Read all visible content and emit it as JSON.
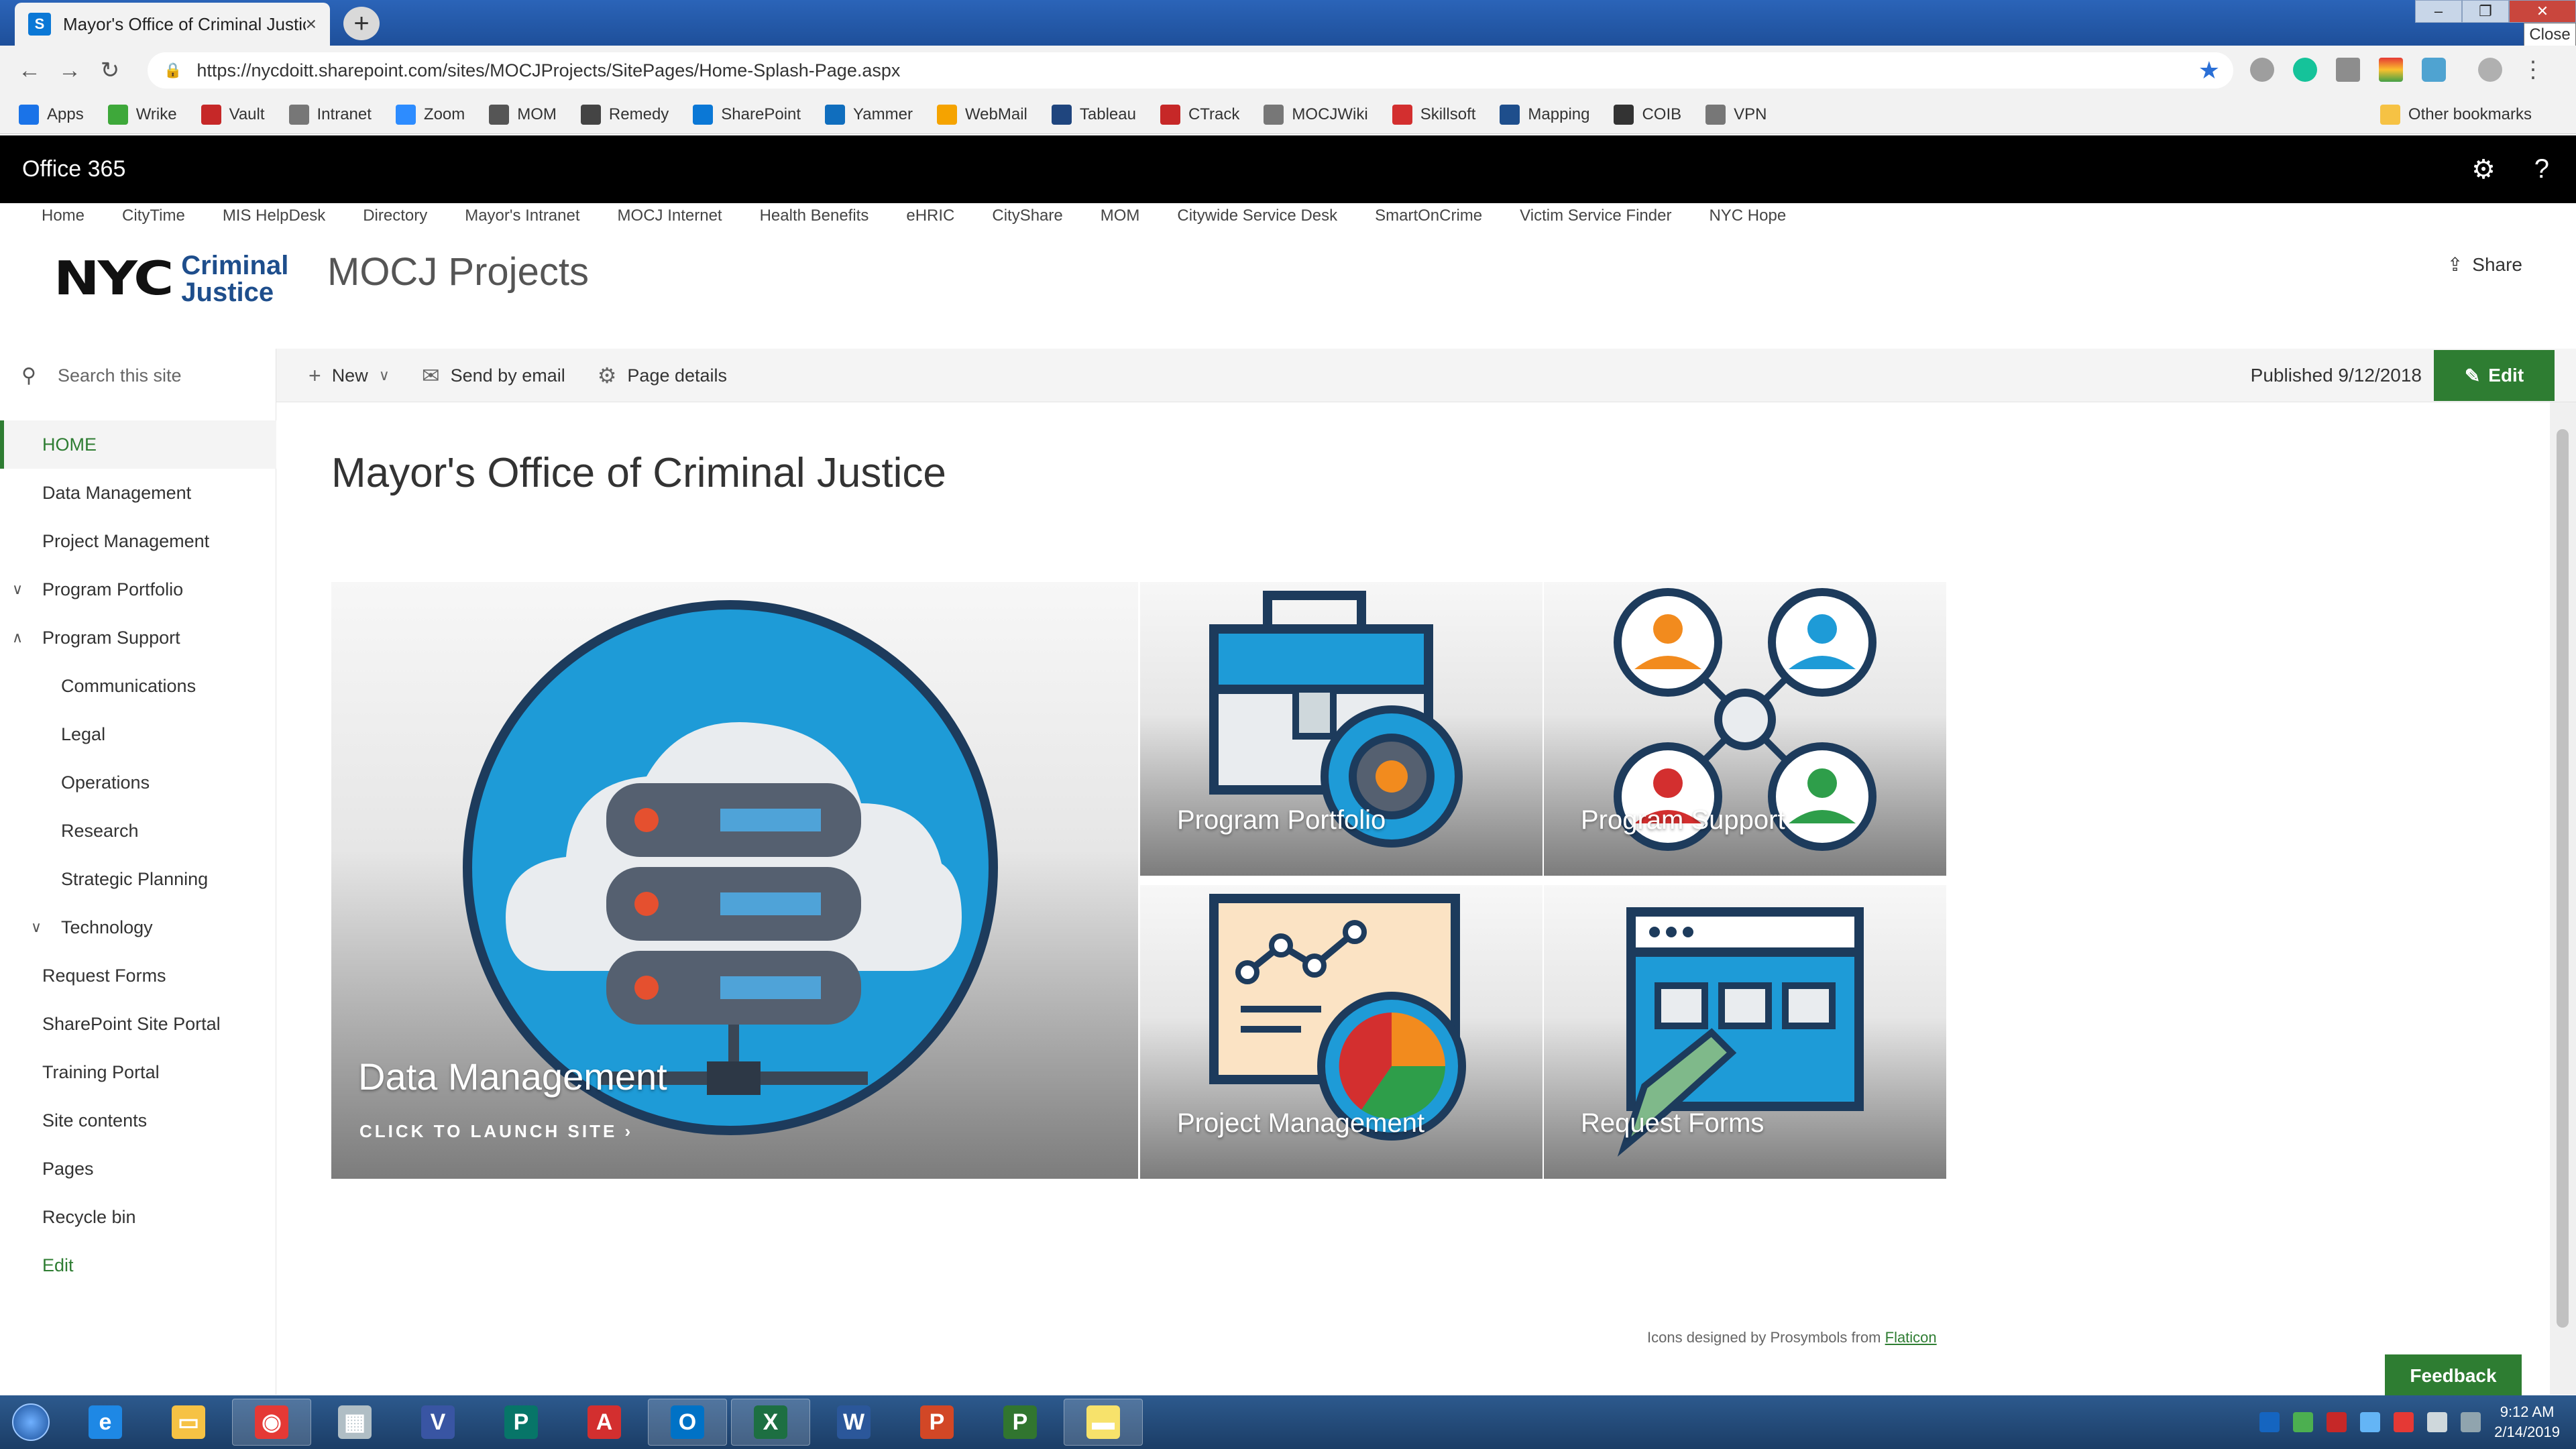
{
  "browser": {
    "tab_title": "Mayor's Office of Criminal Justice",
    "tab_close": "×",
    "new_tab": "+",
    "url": "https://nycdoitt.sharepoint.com/sites/MOCJProjects/SitePages/Home-Splash-Page.aspx",
    "close_tooltip": "Close",
    "bookmarks": [
      {
        "label": "Apps",
        "icon": "apps-grid-icon",
        "color": "#1a73e8"
      },
      {
        "label": "Wrike",
        "icon": "check-icon",
        "color": "#3ea83a"
      },
      {
        "label": "Vault",
        "icon": "vault-icon",
        "color": "#c62828"
      },
      {
        "label": "Intranet",
        "icon": "page-icon",
        "color": "#777777"
      },
      {
        "label": "Zoom",
        "icon": "zoom-icon",
        "color": "#2d8cff"
      },
      {
        "label": "MOM",
        "icon": "person-icon",
        "color": "#555555"
      },
      {
        "label": "Remedy",
        "icon": "remedy-icon",
        "color": "#444444"
      },
      {
        "label": "SharePoint",
        "icon": "sharepoint-icon",
        "color": "#0b78d6"
      },
      {
        "label": "Yammer",
        "icon": "yammer-icon",
        "color": "#106ebe"
      },
      {
        "label": "WebMail",
        "icon": "mail-icon",
        "color": "#f5a300"
      },
      {
        "label": "Tableau",
        "icon": "tableau-icon",
        "color": "#1f457e"
      },
      {
        "label": "CTrack",
        "icon": "ctrack-icon",
        "color": "#c62828"
      },
      {
        "label": "MOCJWiki",
        "icon": "page-icon",
        "color": "#777777"
      },
      {
        "label": "Skillsoft",
        "icon": "skillsoft-icon",
        "color": "#d32f2f"
      },
      {
        "label": "Mapping",
        "icon": "map-icon",
        "color": "#1e4e8c"
      },
      {
        "label": "COIB",
        "icon": "coib-icon",
        "color": "#333333"
      },
      {
        "label": "VPN",
        "icon": "page-icon",
        "color": "#777777"
      }
    ],
    "other_bookmarks": "Other bookmarks"
  },
  "suite_bar": {
    "brand": "Office 365",
    "settings_icon": "gear-icon",
    "help_label": "?"
  },
  "top_nav": [
    "Home",
    "CityTime",
    "MIS HelpDesk",
    "Directory",
    "Mayor's Intranet",
    "MOCJ Internet",
    "Health Benefits",
    "eHRIC",
    "CityShare",
    "MOM",
    "Citywide Service Desk",
    "SmartOnCrime",
    "Victim Service Finder",
    "NYC Hope"
  ],
  "site": {
    "logo_nyc": "NYC",
    "logo_line1": "Criminal",
    "logo_line2": "Justice",
    "title": "MOCJ Projects",
    "share_label": "Share"
  },
  "command_bar": {
    "search_placeholder": "Search this site",
    "new_label": "New",
    "send_label": "Send by email",
    "details_label": "Page details",
    "published": "Published 9/12/2018",
    "edit_label": "Edit"
  },
  "left_nav": [
    {
      "label": "HOME",
      "active": true
    },
    {
      "label": "Data Management"
    },
    {
      "label": "Project Management"
    },
    {
      "label": "Program Portfolio",
      "chevron": "down"
    },
    {
      "label": "Program Support",
      "chevron": "up"
    },
    {
      "label": "Communications",
      "indent": true
    },
    {
      "label": "Legal",
      "indent": true
    },
    {
      "label": "Operations",
      "indent": true
    },
    {
      "label": "Research",
      "indent": true
    },
    {
      "label": "Strategic Planning",
      "indent": true
    },
    {
      "label": "Technology",
      "indent": true,
      "chevron": "down"
    },
    {
      "label": "Request Forms"
    },
    {
      "label": "SharePoint Site Portal"
    },
    {
      "label": "Training Portal"
    },
    {
      "label": "Site contents"
    },
    {
      "label": "Pages"
    },
    {
      "label": "Recycle bin"
    },
    {
      "label": "Edit",
      "green": true
    }
  ],
  "main": {
    "heading": "Mayor's Office of Criminal Justice",
    "tiles": {
      "data_management": {
        "label": "Data Management",
        "cta": "CLICK TO LAUNCH SITE"
      },
      "program_portfolio": {
        "label": "Program Portfolio"
      },
      "program_support": {
        "label": "Program Support"
      },
      "project_management": {
        "label": "Project Management"
      },
      "request_forms": {
        "label": "Request Forms"
      }
    },
    "credit_text": "Icons designed by Prosymbols from",
    "credit_link": "Flaticon",
    "feedback": "Feedback"
  },
  "taskbar": {
    "apps": [
      "internet-explorer-icon",
      "file-explorer-icon",
      "chrome-icon",
      "calculator-icon",
      "visio-icon",
      "publisher-icon",
      "acrobat-icon",
      "outlook-icon",
      "excel-icon",
      "word-icon",
      "powerpoint-icon",
      "project-icon",
      "sticky-notes-icon"
    ],
    "time": "9:12 AM",
    "date": "2/14/2019"
  },
  "colors": {
    "accent_green": "#2e7d32",
    "suite_bar": "#000000",
    "tile_blue": "#1e9bd7",
    "tile_navy": "#1d3b5c"
  }
}
